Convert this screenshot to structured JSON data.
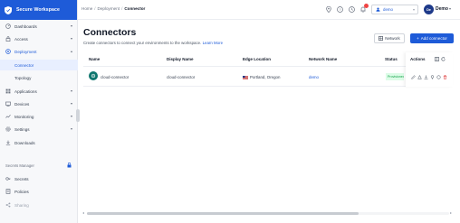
{
  "brand": {
    "title": "Secure Workspace"
  },
  "sidebar": {
    "items": [
      {
        "label": "Dashboards",
        "icon": "dashboard-icon",
        "expandable": true
      },
      {
        "label": "Access",
        "icon": "access-icon",
        "expandable": true
      },
      {
        "label": "Deployment",
        "icon": "deployment-icon",
        "expandable": true,
        "expanded": true
      },
      {
        "label": "Applications",
        "icon": "applications-icon",
        "expandable": true
      },
      {
        "label": "Devices",
        "icon": "devices-icon",
        "expandable": true
      },
      {
        "label": "Monitoring",
        "icon": "monitoring-icon",
        "expandable": true
      },
      {
        "label": "Settings",
        "icon": "settings-icon",
        "expandable": true
      },
      {
        "label": "Downloads",
        "icon": "download-icon",
        "expandable": false
      }
    ],
    "sub_items": [
      {
        "label": "Connector",
        "active": true
      },
      {
        "label": "Topology",
        "active": false
      }
    ],
    "secrets_section": {
      "title": "Secrets Manager",
      "items": [
        {
          "label": "Secrets",
          "icon": "secrets-icon"
        },
        {
          "label": "Policies",
          "icon": "policies-icon"
        },
        {
          "label": "Sharing",
          "icon": "sharing-icon"
        }
      ]
    }
  },
  "topbar": {
    "breadcrumb": [
      "Home",
      "Deployment",
      "Connector"
    ],
    "workspace": "demo",
    "user": {
      "initials": "De",
      "name": "Demo"
    },
    "icons": [
      "location-icon",
      "help-icon",
      "clock-icon",
      "notification-icon"
    ]
  },
  "main": {
    "title": "Connectors",
    "description": "Create connectors to connect your environments to the workspace.",
    "learn_more": "Learn More",
    "network_button": "Network",
    "add_button": "Add connector"
  },
  "table": {
    "columns": [
      "Name",
      "Display Name",
      "Edge Location",
      "Network Name",
      "Status",
      "Actions"
    ],
    "rows": [
      {
        "name": "cloud-connector",
        "display_name": "cloud-connector",
        "edge_location": "Portland, Oregon",
        "network_name": "demo",
        "status": "Provisioned"
      }
    ]
  },
  "colors": {
    "accent": "#1e5bd8",
    "status_green": "#16a34a"
  }
}
